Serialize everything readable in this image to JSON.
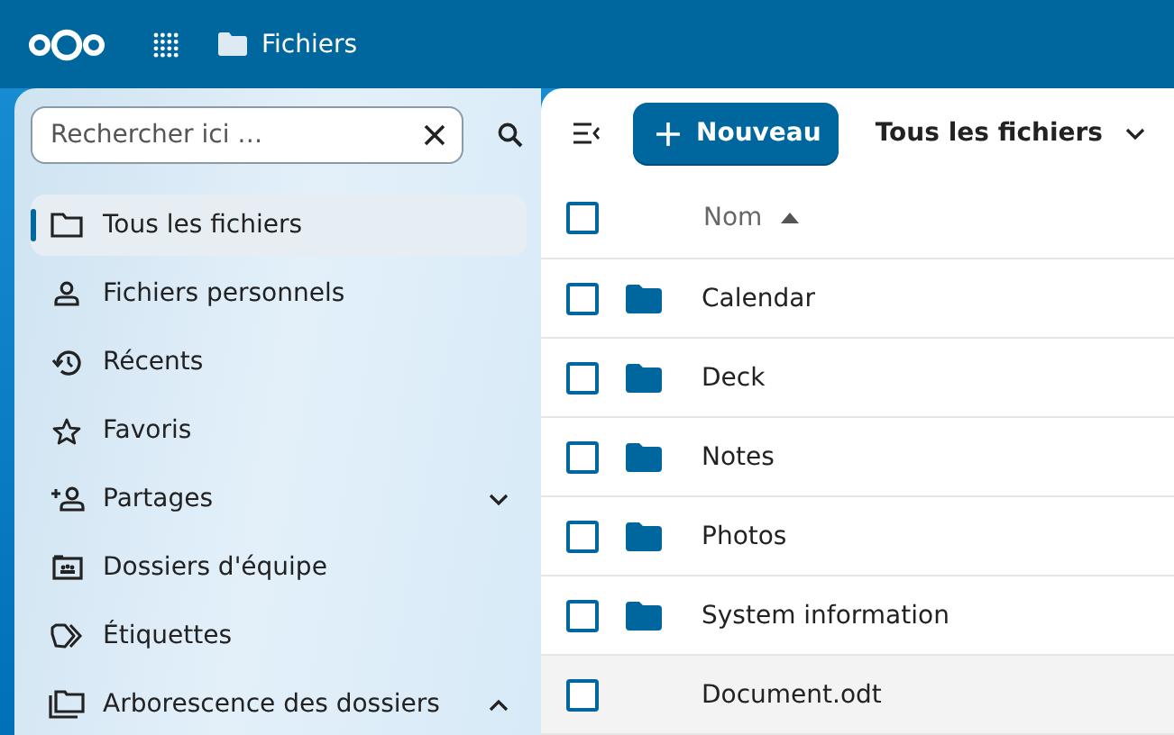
{
  "header": {
    "app_title": "Fichiers"
  },
  "sidebar": {
    "search": {
      "placeholder": "Rechercher ici …"
    },
    "items": [
      {
        "label": "Tous les fichiers",
        "selected": true
      },
      {
        "label": "Fichiers personnels",
        "selected": false
      },
      {
        "label": "Récents",
        "selected": false
      },
      {
        "label": "Favoris",
        "selected": false
      },
      {
        "label": "Partages",
        "selected": false,
        "expanded": false
      },
      {
        "label": "Dossiers d'équipe",
        "selected": false
      },
      {
        "label": "Étiquettes",
        "selected": false
      },
      {
        "label": "Arborescence des dossiers",
        "selected": false,
        "expanded": true
      }
    ]
  },
  "toolbar": {
    "new_button": "Nouveau",
    "view": "Tous les fichiers"
  },
  "table": {
    "select_all_checked": false,
    "columns": [
      {
        "label": "Nom",
        "sort_ascending": true
      }
    ],
    "rows": [
      {
        "name": "Calendar",
        "kind": "folder",
        "checked": false,
        "hovered": false
      },
      {
        "name": "Deck",
        "kind": "folder",
        "checked": false,
        "hovered": false
      },
      {
        "name": "Notes",
        "kind": "folder",
        "checked": false,
        "hovered": false
      },
      {
        "name": "Photos",
        "kind": "folder",
        "checked": false,
        "hovered": false
      },
      {
        "name": "System information",
        "kind": "folder",
        "checked": false,
        "hovered": false
      },
      {
        "name": "Document.odt",
        "kind": "file",
        "checked": false,
        "hovered": true
      }
    ]
  }
}
